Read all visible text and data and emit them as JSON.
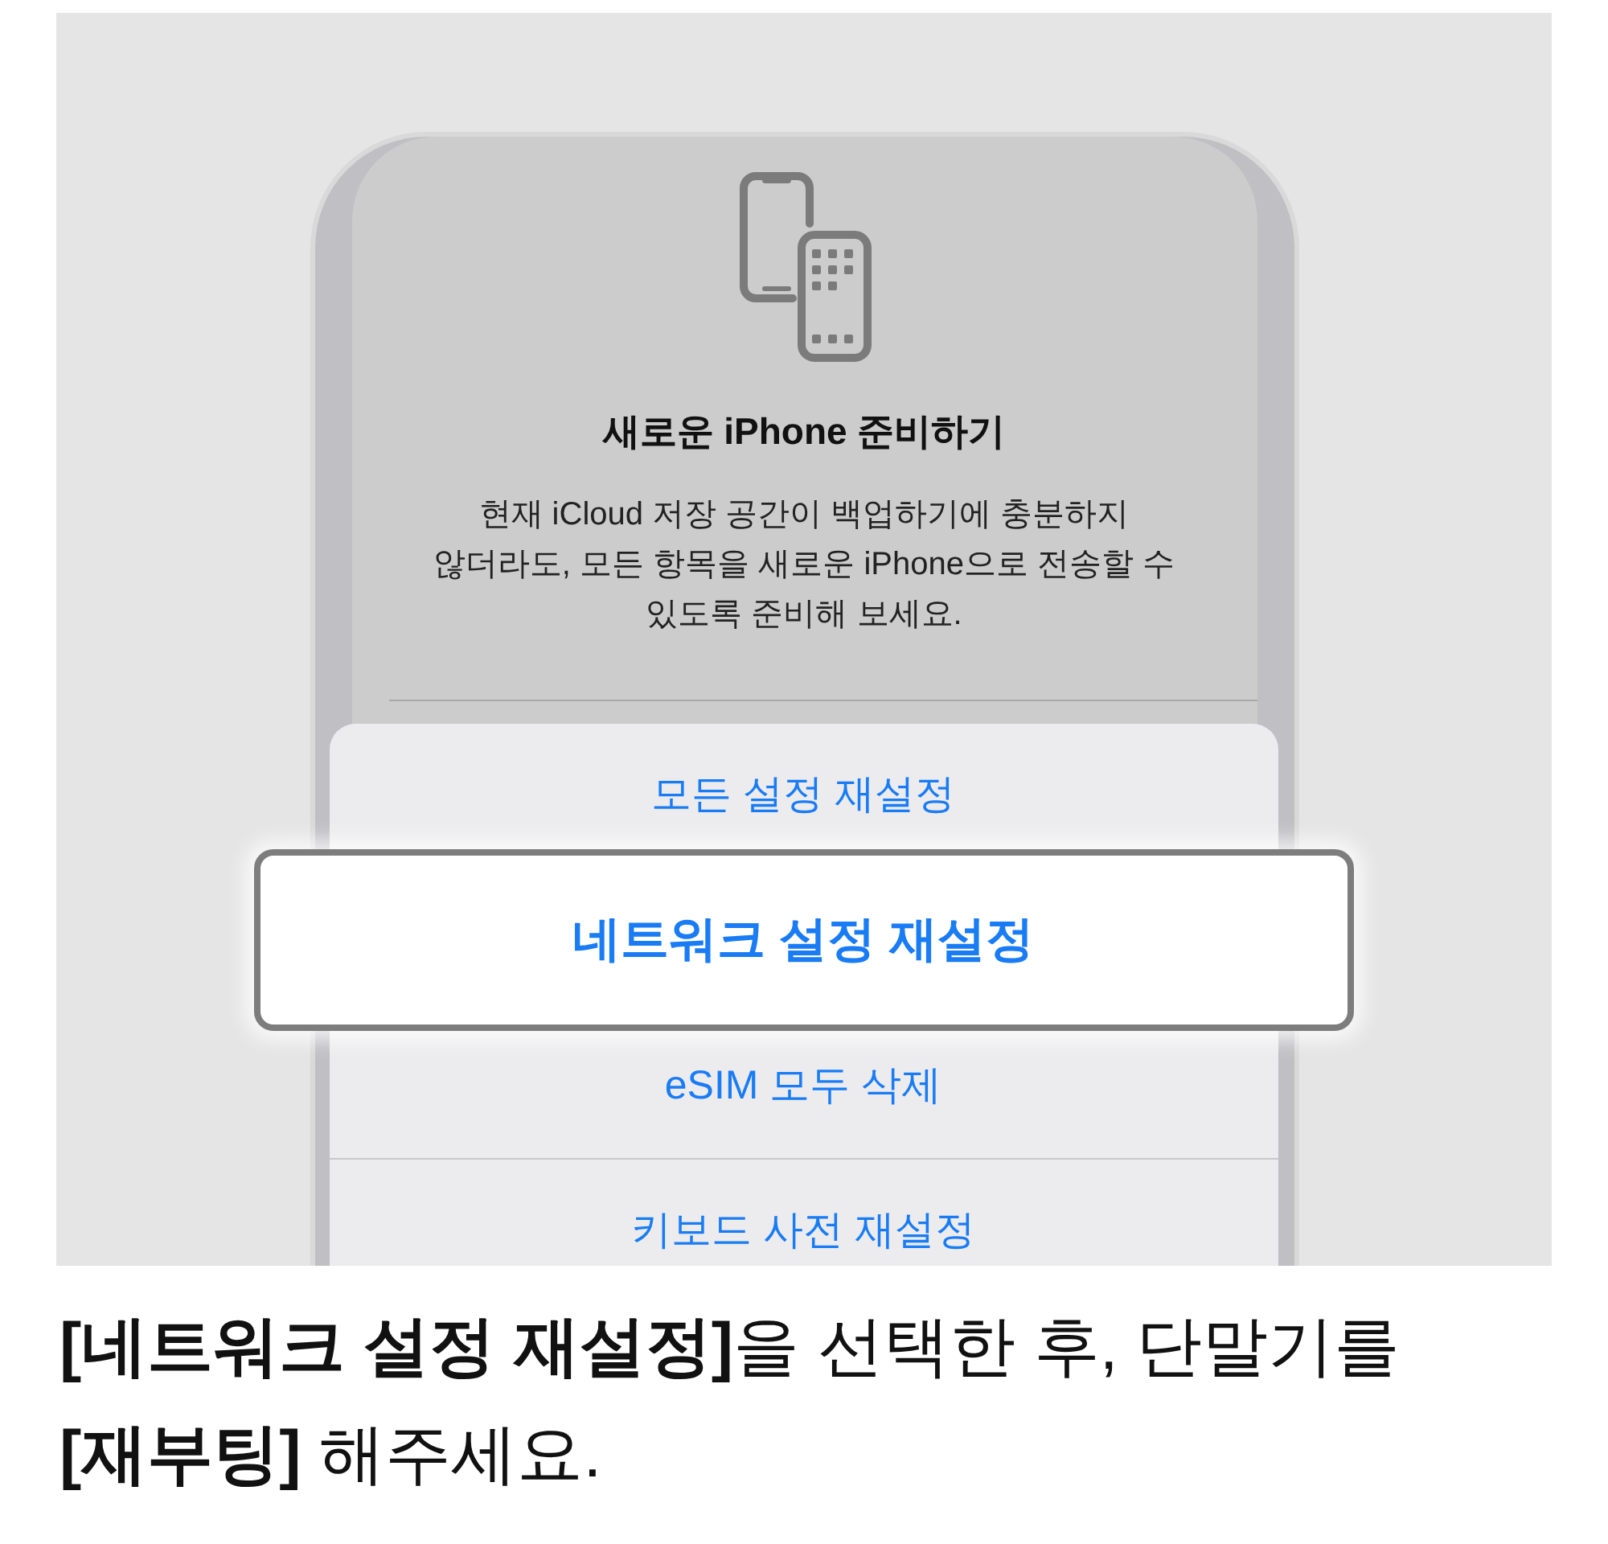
{
  "illustration": {
    "dialog": {
      "title": "새로운 iPhone 준비하기",
      "message_lines": [
        "현재 iCloud 저장 공간이 백업하기에 충분하지",
        "않더라도, 모든 항목을 새로운 iPhone으로 전송할 수",
        "있도록 준비해 보세요."
      ]
    },
    "action_sheet": {
      "items": [
        {
          "label": "모든 설정 재설정",
          "highlighted": false
        },
        {
          "label": "네트워크 설정 재설정",
          "highlighted": true
        },
        {
          "label": "eSIM 모두 삭제",
          "highlighted": false
        },
        {
          "label": "키보드 사전 재설정",
          "highlighted": false
        }
      ]
    }
  },
  "caption_lines": [
    "**[네트워크 설정 재설정]**을 선택한 후, 단말기를",
    "**[재부팅]** 해주세요."
  ]
}
